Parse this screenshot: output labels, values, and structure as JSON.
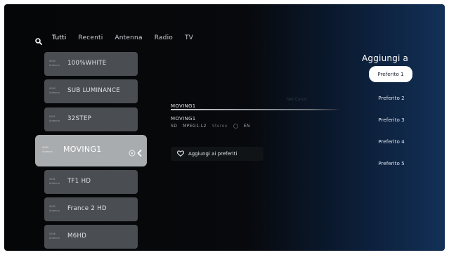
{
  "nav": {
    "search_icon": "search-icon",
    "tabs": [
      {
        "label": "Tutti",
        "active": true
      },
      {
        "label": "Recenti",
        "active": false
      },
      {
        "label": "Antenna",
        "active": false
      },
      {
        "label": "Radio",
        "active": false
      },
      {
        "label": "TV",
        "active": false
      }
    ]
  },
  "channels": [
    {
      "num": "0000",
      "src": "Antenna",
      "name": "100%WHITE"
    },
    {
      "num": "0000",
      "src": "Antenna",
      "name": "SUB LUMINANCE"
    },
    {
      "num": "0001",
      "src": "Antenna",
      "name": "32STEP"
    },
    {
      "num": "0000",
      "src": "Antenna",
      "name": "MOVING1",
      "selected": true
    },
    {
      "num": "0001",
      "src": "Antenna",
      "name": "TF1 HD"
    },
    {
      "num": "0002",
      "src": "Antenna",
      "name": "France 2 HD"
    },
    {
      "num": "0006",
      "src": "Antenna",
      "name": "M6HD"
    }
  ],
  "program": {
    "channel_name": "MOVING1",
    "faint_text": "Nel Canal",
    "progress": 0.98,
    "title": "MOVING1",
    "tags": [
      "SD",
      "MPEG1-L2",
      "Stereo",
      "EN"
    ],
    "favorite_button": "Aggiungi ai preferiti"
  },
  "add_to": {
    "title": "Aggiungi a",
    "options": [
      {
        "label": "Preferito 1",
        "active": true
      },
      {
        "label": "Preferito 2",
        "active": false
      },
      {
        "label": "Preferito 3",
        "active": false
      },
      {
        "label": "Preferito 4",
        "active": false
      },
      {
        "label": "Preferito 5",
        "active": false
      }
    ]
  },
  "colors": {
    "accent": "#ffffff",
    "panel_blue": "#123057"
  }
}
